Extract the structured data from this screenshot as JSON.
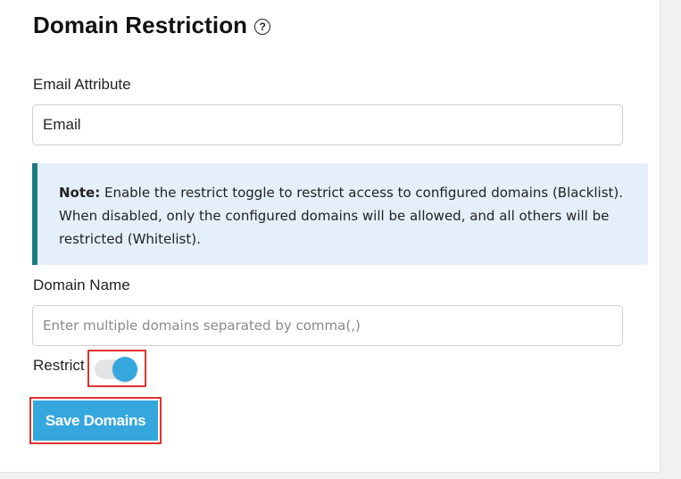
{
  "header": {
    "title": "Domain Restriction",
    "help_icon": "question-circle-icon"
  },
  "email_attribute": {
    "label": "Email Attribute",
    "value": "Email"
  },
  "note": {
    "prefix": "Note:",
    "text": " Enable the restrict toggle to restrict access to configured domains (Blacklist). When disabled, only the configured domains will be allowed, and all others will be restricted (Whitelist).",
    "accent_color": "#1f7a85",
    "background_color": "#e4effa"
  },
  "domain_name": {
    "label": "Domain Name",
    "value": "",
    "placeholder": "Enter multiple domains separated by comma(,)"
  },
  "restrict": {
    "label": "Restrict",
    "enabled": true,
    "color": "#35a7de"
  },
  "actions": {
    "save_label": "Save Domains",
    "button_color": "#35a7de",
    "highlight_color": "#e03131"
  }
}
